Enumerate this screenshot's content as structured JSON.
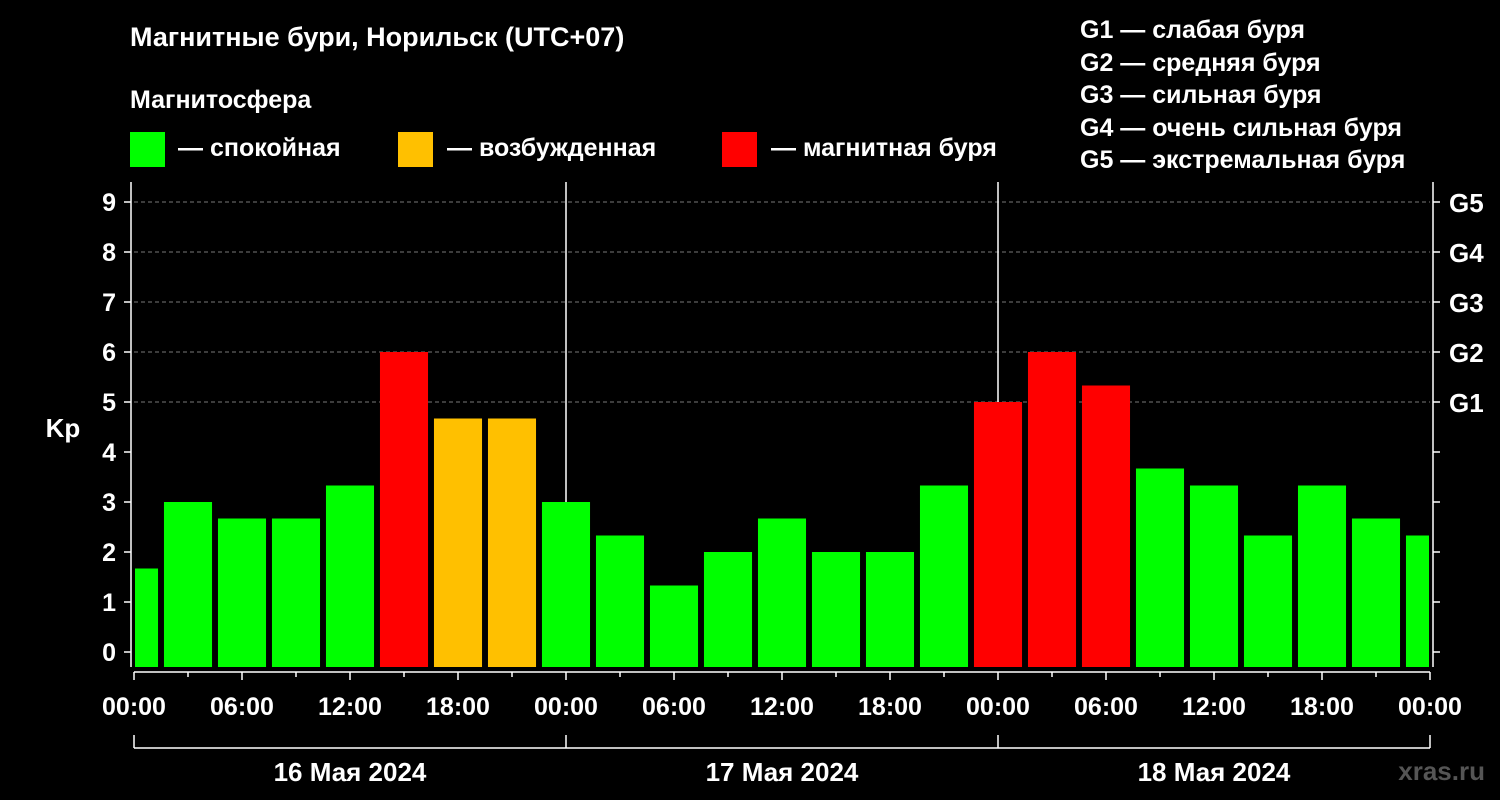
{
  "title": "Магнитные бури, Норильск (UTC+07)",
  "legend": {
    "title": "Магнитосфера",
    "items": [
      {
        "label": "— спокойная",
        "color": "#00ff00"
      },
      {
        "label": "— возбужденная",
        "color": "#ffc000"
      },
      {
        "label": "— магнитная буря",
        "color": "#ff0000"
      }
    ]
  },
  "g_scale": [
    "G1 — слабая буря",
    "G2 — средняя буря",
    "G3 — сильная буря",
    "G4 — очень сильная буря",
    "G5 — экстремальная буря"
  ],
  "watermark": "xras.ru",
  "chart_data": {
    "type": "bar",
    "ylabel": "Kp",
    "ylim": [
      0,
      9
    ],
    "yticks": [
      "0",
      "1",
      "2",
      "3",
      "4",
      "5",
      "6",
      "7",
      "8",
      "9"
    ],
    "right_ticks": [
      {
        "value": 5,
        "label": "G1"
      },
      {
        "value": 6,
        "label": "G2"
      },
      {
        "value": 7,
        "label": "G3"
      },
      {
        "value": 8,
        "label": "G4"
      },
      {
        "value": 9,
        "label": "G5"
      }
    ],
    "grid": "dashed horizontal lines at Kp 5–9",
    "xticks": [
      "00:00",
      "06:00",
      "12:00",
      "18:00",
      "00:00",
      "06:00",
      "12:00",
      "18:00",
      "00:00",
      "06:00",
      "12:00",
      "18:00",
      "00:00"
    ],
    "dates": [
      "16 Мая 2024",
      "17 Мая 2024",
      "18 Мая 2024"
    ],
    "bars": [
      {
        "time": "16 Мая 2024 00:00",
        "kp": 1.67,
        "state": "quiet"
      },
      {
        "time": "16 Мая 2024 03:00",
        "kp": 3.0,
        "state": "quiet"
      },
      {
        "time": "16 Мая 2024 06:00",
        "kp": 2.67,
        "state": "quiet"
      },
      {
        "time": "16 Мая 2024 09:00",
        "kp": 2.67,
        "state": "quiet"
      },
      {
        "time": "16 Мая 2024 12:00",
        "kp": 3.33,
        "state": "quiet"
      },
      {
        "time": "16 Мая 2024 15:00",
        "kp": 6.0,
        "state": "storm"
      },
      {
        "time": "16 Мая 2024 18:00",
        "kp": 4.67,
        "state": "active"
      },
      {
        "time": "16 Мая 2024 21:00",
        "kp": 4.67,
        "state": "active"
      },
      {
        "time": "17 Мая 2024 00:00",
        "kp": 3.0,
        "state": "quiet"
      },
      {
        "time": "17 Мая 2024 03:00",
        "kp": 2.33,
        "state": "quiet"
      },
      {
        "time": "17 Мая 2024 06:00",
        "kp": 1.33,
        "state": "quiet"
      },
      {
        "time": "17 Мая 2024 09:00",
        "kp": 2.0,
        "state": "quiet"
      },
      {
        "time": "17 Мая 2024 12:00",
        "kp": 2.67,
        "state": "quiet"
      },
      {
        "time": "17 Мая 2024 15:00",
        "kp": 2.0,
        "state": "quiet"
      },
      {
        "time": "17 Мая 2024 18:00",
        "kp": 2.0,
        "state": "quiet"
      },
      {
        "time": "17 Мая 2024 21:00",
        "kp": 3.33,
        "state": "quiet"
      },
      {
        "time": "18 Мая 2024 00:00",
        "kp": 5.0,
        "state": "storm"
      },
      {
        "time": "18 Мая 2024 03:00",
        "kp": 6.0,
        "state": "storm"
      },
      {
        "time": "18 Мая 2024 06:00",
        "kp": 5.33,
        "state": "storm"
      },
      {
        "time": "18 Мая 2024 09:00",
        "kp": 3.67,
        "state": "quiet"
      },
      {
        "time": "18 Мая 2024 12:00",
        "kp": 3.33,
        "state": "quiet"
      },
      {
        "time": "18 Мая 2024 15:00",
        "kp": 2.33,
        "state": "quiet"
      },
      {
        "time": "18 Мая 2024 18:00",
        "kp": 3.33,
        "state": "quiet"
      },
      {
        "time": "18 Мая 2024 21:00",
        "kp": 2.67,
        "state": "quiet"
      },
      {
        "time": "19 Мая 2024 00:00",
        "kp": 2.33,
        "state": "quiet"
      }
    ],
    "colors": {
      "quiet": "#00ff00",
      "active": "#ffc000",
      "storm": "#ff0000"
    }
  }
}
